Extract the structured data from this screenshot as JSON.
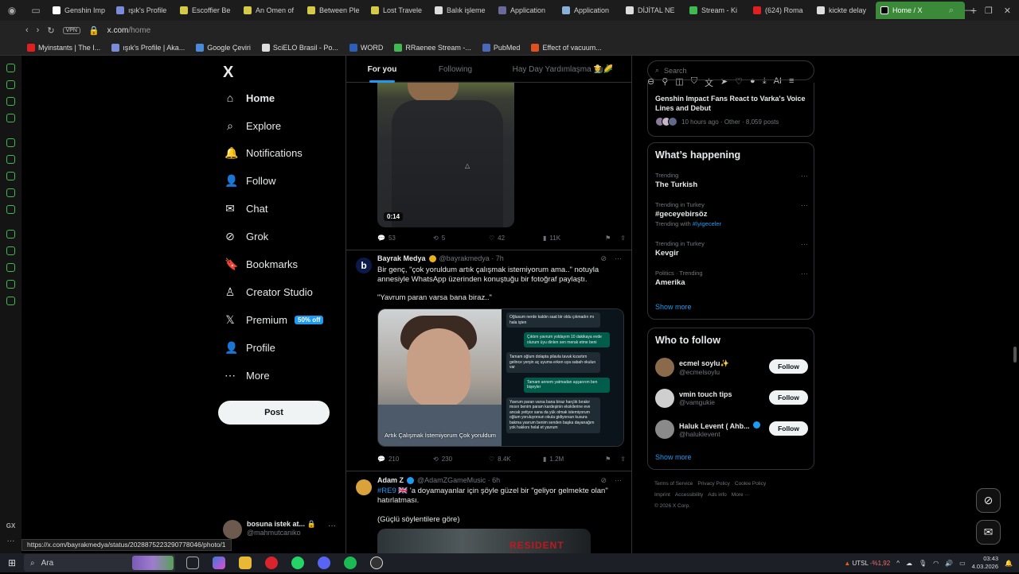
{
  "browser": {
    "tabs": [
      {
        "label": "Genshin Imp",
        "color": "#ffffff"
      },
      {
        "label": "ışık's Profile",
        "color": "#7a8bd8"
      },
      {
        "label": "Escoffier Be",
        "color": "#d4c94a"
      },
      {
        "label": "An Omen of",
        "color": "#d4c94a"
      },
      {
        "label": "Between Ple",
        "color": "#d4c94a"
      },
      {
        "label": "Lost Travele",
        "color": "#d4c94a"
      },
      {
        "label": "Balık işleme",
        "color": "#dddddd"
      },
      {
        "label": "Application",
        "color": "#6a6a9a"
      },
      {
        "label": "Application",
        "color": "#8ab0d8"
      },
      {
        "label": "DİJİTAL NE",
        "color": "#dddddd"
      },
      {
        "label": "Stream - Ki",
        "color": "#3fb950"
      },
      {
        "label": "(624) Roma",
        "color": "#e02020"
      },
      {
        "label": "kickte delay",
        "color": "#dddddd"
      }
    ],
    "active_tab": "Home / X",
    "url": "x.com",
    "url_path": "/home",
    "vpn_label": "VPN",
    "bookmarks": [
      {
        "label": "Myinstants | The I...",
        "color": "#e02020"
      },
      {
        "label": "ışık's Profile | Aka...",
        "color": "#7a8bd8"
      },
      {
        "label": "Google Çeviri",
        "color": "#4a8ad8"
      },
      {
        "label": "SciELO Brasil - Po...",
        "color": "#dddddd"
      },
      {
        "label": "WORD",
        "color": "#2b5fb8"
      },
      {
        "label": "RRaenee Stream -...",
        "color": "#3fb950"
      },
      {
        "label": "PubMed",
        "color": "#4a6ab8"
      },
      {
        "label": "Effect of vacuum...",
        "color": "#e05020"
      }
    ],
    "status_url": "https://x.com/bayrakmedya/status/2028875223290778046/photo/1"
  },
  "nav": {
    "logo": "X",
    "items": [
      {
        "label": "Home",
        "icon": "home-icon",
        "glyph": "⌂"
      },
      {
        "label": "Explore",
        "icon": "search-icon",
        "glyph": "⌕"
      },
      {
        "label": "Notifications",
        "icon": "bell-icon",
        "glyph": "🔔"
      },
      {
        "label": "Follow",
        "icon": "person-add-icon",
        "glyph": "👤"
      },
      {
        "label": "Chat",
        "icon": "mail-icon",
        "glyph": "✉"
      },
      {
        "label": "Grok",
        "icon": "grok-icon",
        "glyph": "⊘"
      },
      {
        "label": "Bookmarks",
        "icon": "bookmark-icon",
        "glyph": "🔖"
      },
      {
        "label": "Creator Studio",
        "icon": "creator-icon",
        "glyph": "♙"
      },
      {
        "label": "Premium",
        "icon": "x-icon",
        "glyph": "𝕏"
      },
      {
        "label": "Profile",
        "icon": "profile-icon",
        "glyph": "👤"
      },
      {
        "label": "More",
        "icon": "more-icon",
        "glyph": "⋯"
      }
    ],
    "premium_badge": "50% off",
    "post_label": "Post",
    "account": {
      "name": "bosuna istek at...",
      "handle": "@mahmutcaniko"
    }
  },
  "feed": {
    "tabs": [
      "For you",
      "Following",
      "Hay Day Yardımlaşma 👩‍🌾🌽"
    ],
    "video_duration": "0:14",
    "tweet0_stats": {
      "replies": "53",
      "reposts": "5",
      "likes": "42",
      "views": "11K"
    },
    "tweet1": {
      "name": "Bayrak Medya",
      "handle": "@bayrakmedya · 7h",
      "text1": "Bir genç, \"çok yoruldum artık çalışmak istemiyorum ama..\" notuyla annesiyle WhatsApp üzerinden konuştuğu bir fotoğraf paylaştı.",
      "text2": "\"Yavrum paran varsa bana biraz..\"",
      "caption": "Artık Çalışmak İstemiyorum Çok yoruldum",
      "chat": [
        {
          "dir": "in",
          "text": "Oğlusum nerde kaldın saat bir oldu çıkmadın mı hala işten"
        },
        {
          "dir": "out",
          "text": "Çıktım yavrum yoldayım 10 dakikaya evde olurum üyu dinlen sen merak etme beni"
        },
        {
          "dir": "in",
          "text": "Tamam oğlum dolapta pilavla tavuk kızartım gelince yerşin aç uyuma erken uya sabah okulun var"
        },
        {
          "dir": "out",
          "text": "Tamam annem yatmadan aşşarırım ben bişeyler"
        },
        {
          "dir": "in",
          "text": "Yavrum paran varsa bana biraz harçlık bırakır mısın benim param kardeşinin ekskilerine eve ancak yetiyor sana da yük olmak istemiyorum oğlum yoruluyorsun okula gidiyorsun kusura bakma yavrum benim senden başka dayanağım yok hakkını helal et yavrum"
        }
      ],
      "stats": {
        "replies": "210",
        "reposts": "230",
        "likes": "8.4K",
        "views": "1.2M"
      }
    },
    "tweet2": {
      "name": "Adam Z",
      "handle": "@AdamZGameMusic · 6h",
      "hashtag": "#RE9",
      "text1": " 'a doyamayanlar için şöyle güzel bir \"geliyor gelmekte olan\" hatırlatması.",
      "text2": "(Güçlü söylentilere göre)",
      "thumb_title": "RESIDENT EVIL"
    }
  },
  "right": {
    "search_placeholder": "Search",
    "news_title": "Genshin Impact Fans React to Varka's Voice Lines and Debut",
    "news_meta": "10 hours ago · Other · 8,059 posts",
    "happening_title": "What’s happening",
    "trends": [
      {
        "cat": "Trending",
        "name": "The Turkish",
        "sub": ""
      },
      {
        "cat": "Trending in Turkey",
        "name": "#geceyebirsöz",
        "sub": "Trending with ",
        "sub_tag": "#İyigeceler"
      },
      {
        "cat": "Trending in Turkey",
        "name": "Kevgir",
        "sub": ""
      },
      {
        "cat": "Politics · Trending",
        "name": "Amerika",
        "sub": ""
      }
    ],
    "show_more": "Show more",
    "wtf_title": "Who to follow",
    "wtf": [
      {
        "name": "ecmel soylu✨",
        "handle": "@ecmelsoylu",
        "btn": "Follow"
      },
      {
        "name": "vmin touch tips",
        "handle": "@vamgukie",
        "btn": "Follow"
      },
      {
        "name": "Haluk Levent ( Ahb...",
        "handle": "@haluklevent",
        "btn": "Follow"
      }
    ],
    "footer": [
      "Terms of Service",
      "Privacy Policy",
      "Cookie Policy",
      "Imprint",
      "Accessibility",
      "Ads info",
      "More ···",
      "© 2026 X Corp."
    ]
  },
  "taskbar": {
    "search_label": "Ara",
    "stock_name": "UTSL",
    "stock_change": "-%1,92",
    "time": "03:43",
    "date": "4.03.2026"
  }
}
